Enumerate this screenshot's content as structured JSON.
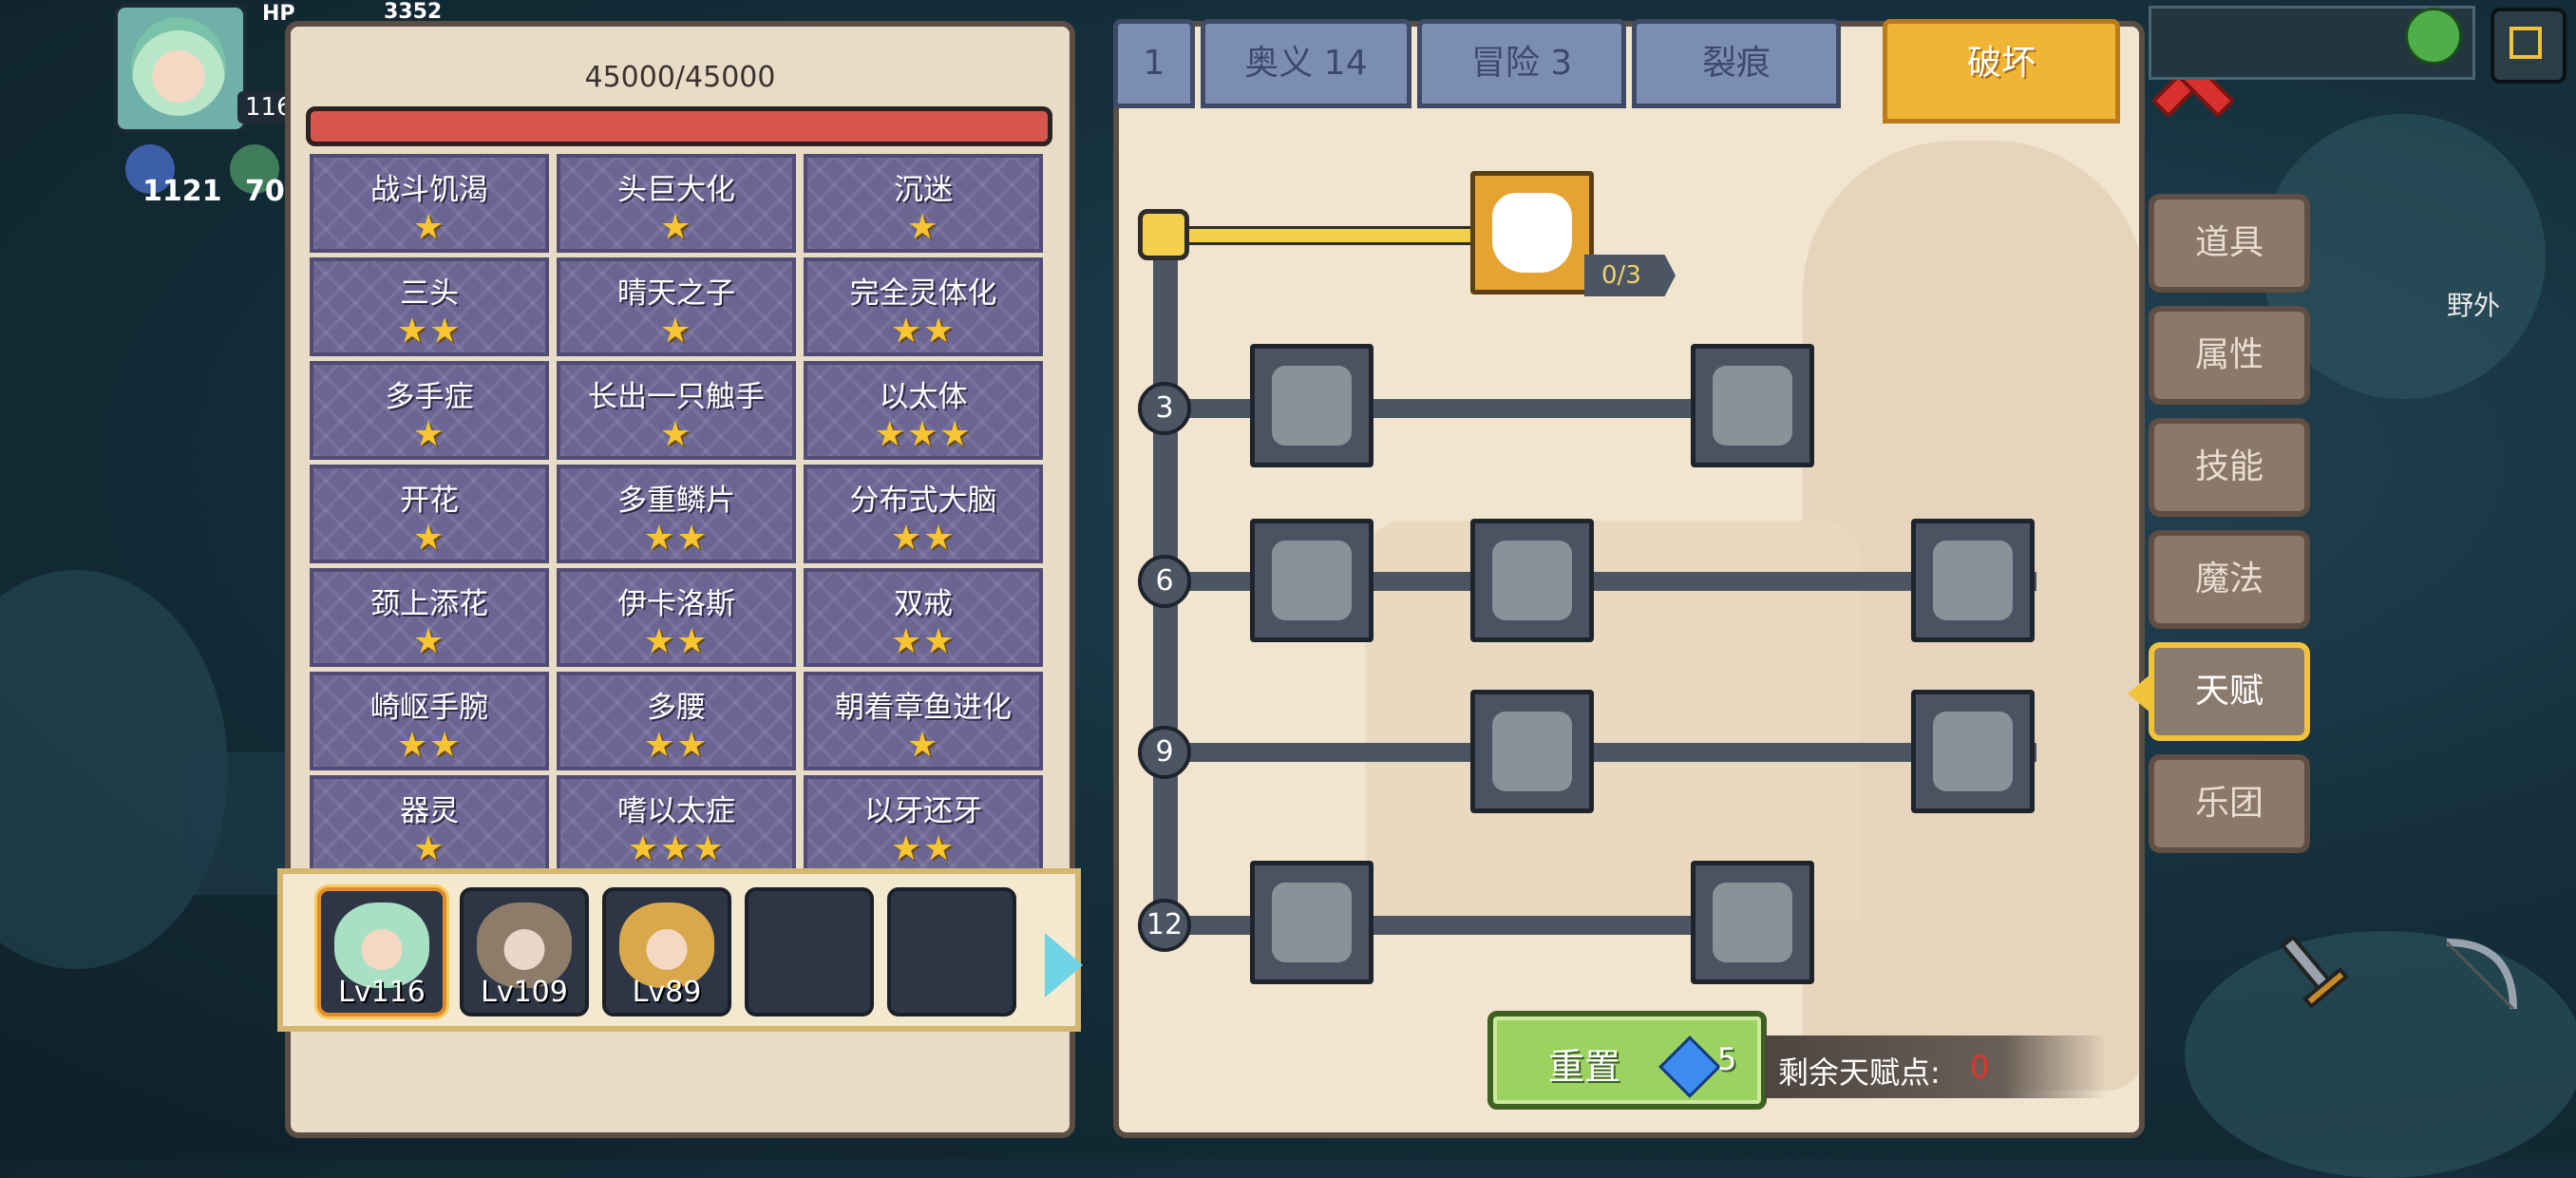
{
  "hud": {
    "hp_label": "HP",
    "hp_value": "3352",
    "level": "116",
    "resources": [
      {
        "name": "crystal",
        "value": "1121"
      },
      {
        "name": "gem",
        "value": "70"
      }
    ]
  },
  "left_panel": {
    "hp_text": "45000/45000",
    "traits": [
      {
        "name": "战斗饥渴",
        "stars": "★"
      },
      {
        "name": "头巨大化",
        "stars": "★"
      },
      {
        "name": "沉迷",
        "stars": "★"
      },
      {
        "name": "三头",
        "stars": "★★"
      },
      {
        "name": "晴天之子",
        "stars": "★"
      },
      {
        "name": "完全灵体化",
        "stars": "★★"
      },
      {
        "name": "多手症",
        "stars": "★"
      },
      {
        "name": "长出一只触手",
        "stars": "★"
      },
      {
        "name": "以太体",
        "stars": "★★★"
      },
      {
        "name": "开花",
        "stars": "★"
      },
      {
        "name": "多重鳞片",
        "stars": "★★"
      },
      {
        "name": "分布式大脑",
        "stars": "★★"
      },
      {
        "name": "颈上添花",
        "stars": "★"
      },
      {
        "name": "伊卡洛斯",
        "stars": "★★"
      },
      {
        "name": "双戒",
        "stars": "★★"
      },
      {
        "name": "崎岖手腕",
        "stars": "★★"
      },
      {
        "name": "多腰",
        "stars": "★★"
      },
      {
        "name": "朝着章鱼进化",
        "stars": "★"
      },
      {
        "name": "器灵",
        "stars": "★"
      },
      {
        "name": "嗜以太症",
        "stars": "★★★"
      },
      {
        "name": "以牙还牙",
        "stars": "★★"
      }
    ],
    "party": [
      {
        "level": "Lv116"
      },
      {
        "level": "Lv109"
      },
      {
        "level": "Lv89"
      },
      {
        "level": ""
      },
      {
        "level": ""
      }
    ]
  },
  "tabs": [
    {
      "label": "1"
    },
    {
      "label": "奥义 14"
    },
    {
      "label": "冒险 3"
    },
    {
      "label": "裂痕"
    },
    {
      "label": "破坏"
    }
  ],
  "talent_tree": {
    "rows": [
      "3",
      "6",
      "9",
      "12"
    ],
    "top_node_progress": "0/3"
  },
  "bottom": {
    "reset_label": "重置",
    "reset_cost": "5",
    "remaining_label": "剩余天赋点:",
    "remaining_value": "0"
  },
  "side_menu": [
    "道具",
    "属性",
    "技能",
    "魔法",
    "天赋",
    "乐团"
  ],
  "world": {
    "area_label": "野外"
  },
  "colors": {
    "accent": "#f1b535",
    "trait_bg": "#6a6592",
    "hp_red": "#d6564c",
    "remaining_red": "#e2342c"
  }
}
